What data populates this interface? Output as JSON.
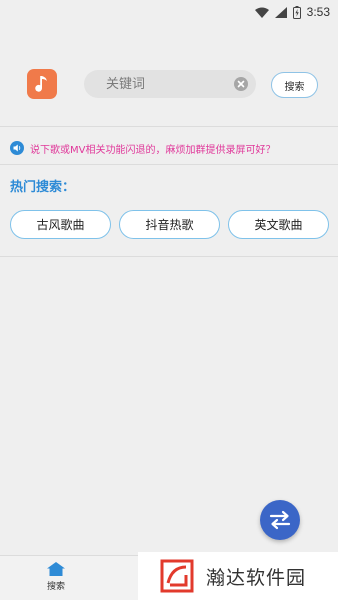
{
  "status_bar": {
    "time": "3:53",
    "icons": [
      "wifi-icon",
      "signal-icon",
      "battery-charging-icon"
    ]
  },
  "header": {
    "app_icon": "music-note-icon",
    "search": {
      "placeholder": "关键词",
      "value": ""
    },
    "clear_icon": "clear-circle-icon",
    "search_button_label": "搜索"
  },
  "notice": {
    "icon": "speaker-icon",
    "text": "说下歌或MV相关功能闪退的，麻烦加群提供录屏可好？"
  },
  "hot_search": {
    "title": "热门搜索：",
    "chips": [
      {
        "label": "古风歌曲"
      },
      {
        "label": "抖音热歌"
      },
      {
        "label": "英文歌曲"
      }
    ]
  },
  "fab": {
    "icon": "swap-arrows-icon"
  },
  "bottom_nav": {
    "items": [
      {
        "label": "搜索",
        "icon": "home-icon"
      }
    ]
  },
  "watermark": {
    "text": "瀚达软件园"
  },
  "colors": {
    "background": "#efefef",
    "accent_blue": "#2e8bd6",
    "notice_pink": "#e0389a",
    "app_icon_orange": "#f07a4a",
    "fab_blue": "#3b66c7"
  }
}
